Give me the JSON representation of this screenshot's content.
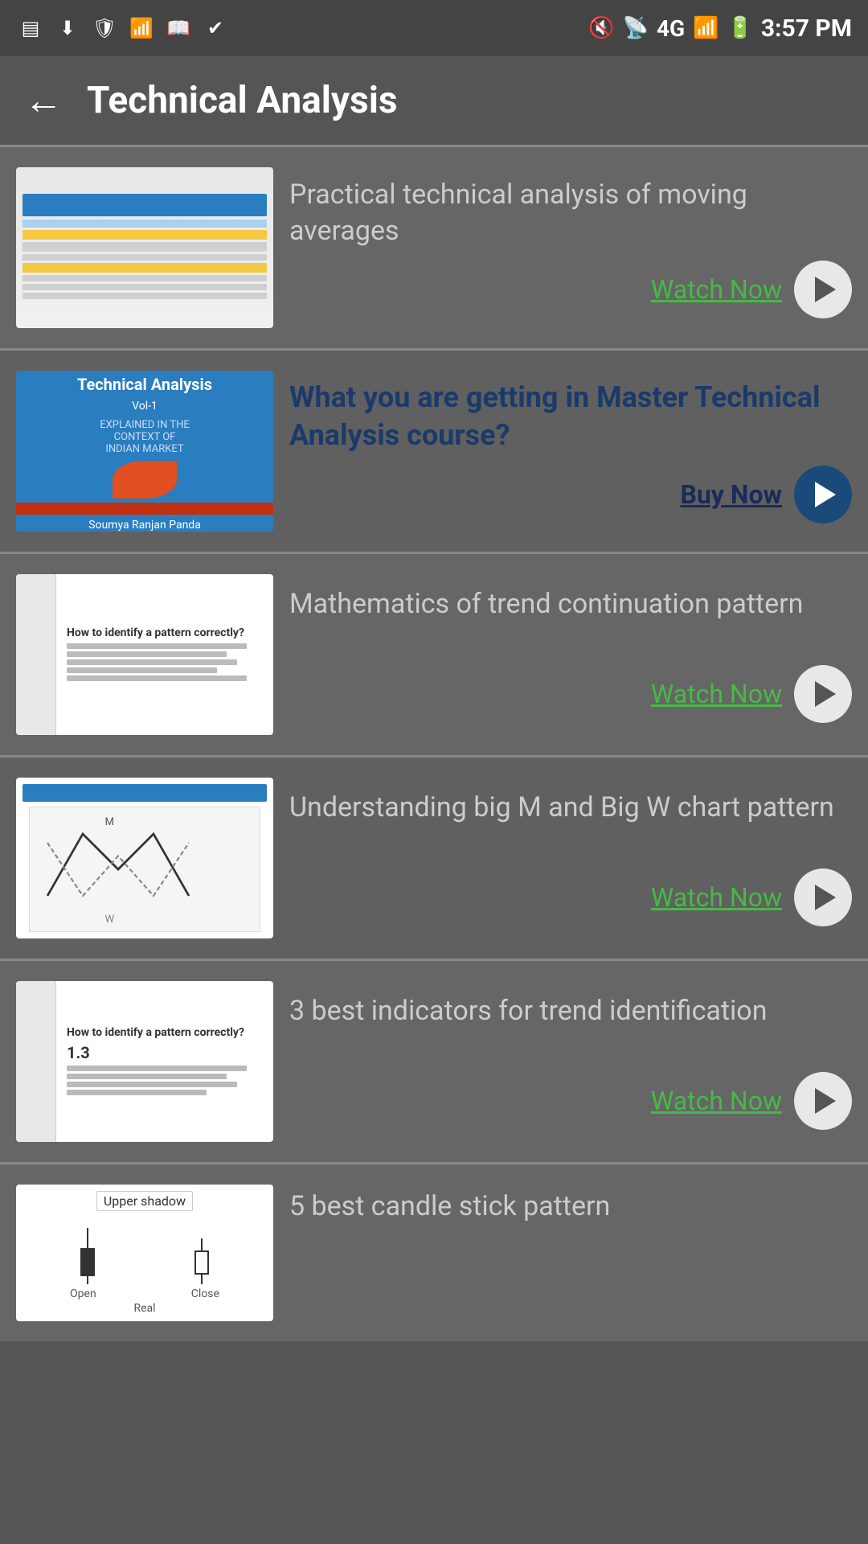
{
  "statusBar": {
    "time": "3:57 PM",
    "network": "4G"
  },
  "header": {
    "backLabel": "←",
    "title": "Technical Analysis"
  },
  "cards": [
    {
      "id": "card-1",
      "title": "Practical technical analysis of moving averages",
      "actionLabel": "Watch Now",
      "actionType": "watch",
      "thumbnailType": "website"
    },
    {
      "id": "card-2",
      "title": "What you are getting in Master Technical Analysis course?",
      "actionLabel": "Buy Now",
      "actionType": "buy",
      "thumbnailType": "book"
    },
    {
      "id": "card-3",
      "title": "Mathematics of trend continuation pattern",
      "actionLabel": "Watch Now",
      "actionType": "watch",
      "thumbnailType": "slide"
    },
    {
      "id": "card-4",
      "title": "Understanding big M and Big W chart pattern",
      "actionLabel": "Watch Now",
      "actionType": "watch",
      "thumbnailType": "diagram"
    },
    {
      "id": "card-5",
      "title": "3 best indicators for trend identification",
      "actionLabel": "Watch Now",
      "actionType": "watch",
      "thumbnailType": "slide2"
    },
    {
      "id": "card-6",
      "title": "5 best candle stick pattern",
      "actionLabel": "",
      "actionType": "watch",
      "thumbnailType": "candle",
      "partial": true
    }
  ]
}
